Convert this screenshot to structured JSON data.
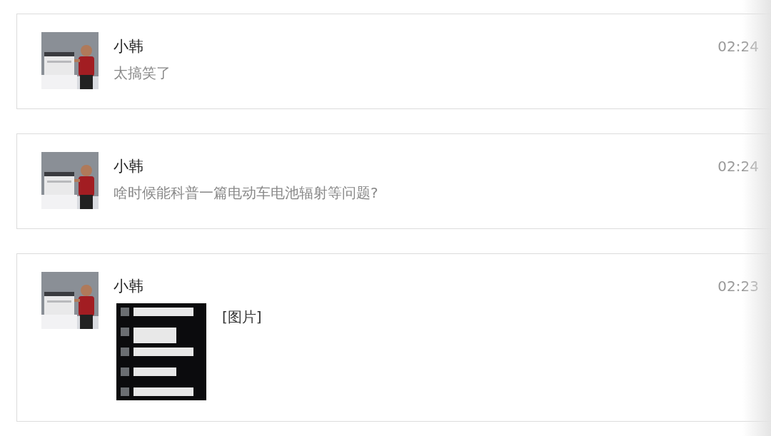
{
  "messages": [
    {
      "sender": "小韩",
      "time": "02:24",
      "kind": "text",
      "text": "太搞笑了"
    },
    {
      "sender": "小韩",
      "time": "02:24",
      "kind": "text",
      "text": "啥时候能科普一篇电动车电池辐射等问题?"
    },
    {
      "sender": "小韩",
      "time": "02:23",
      "text": "[图片]"
    }
  ]
}
